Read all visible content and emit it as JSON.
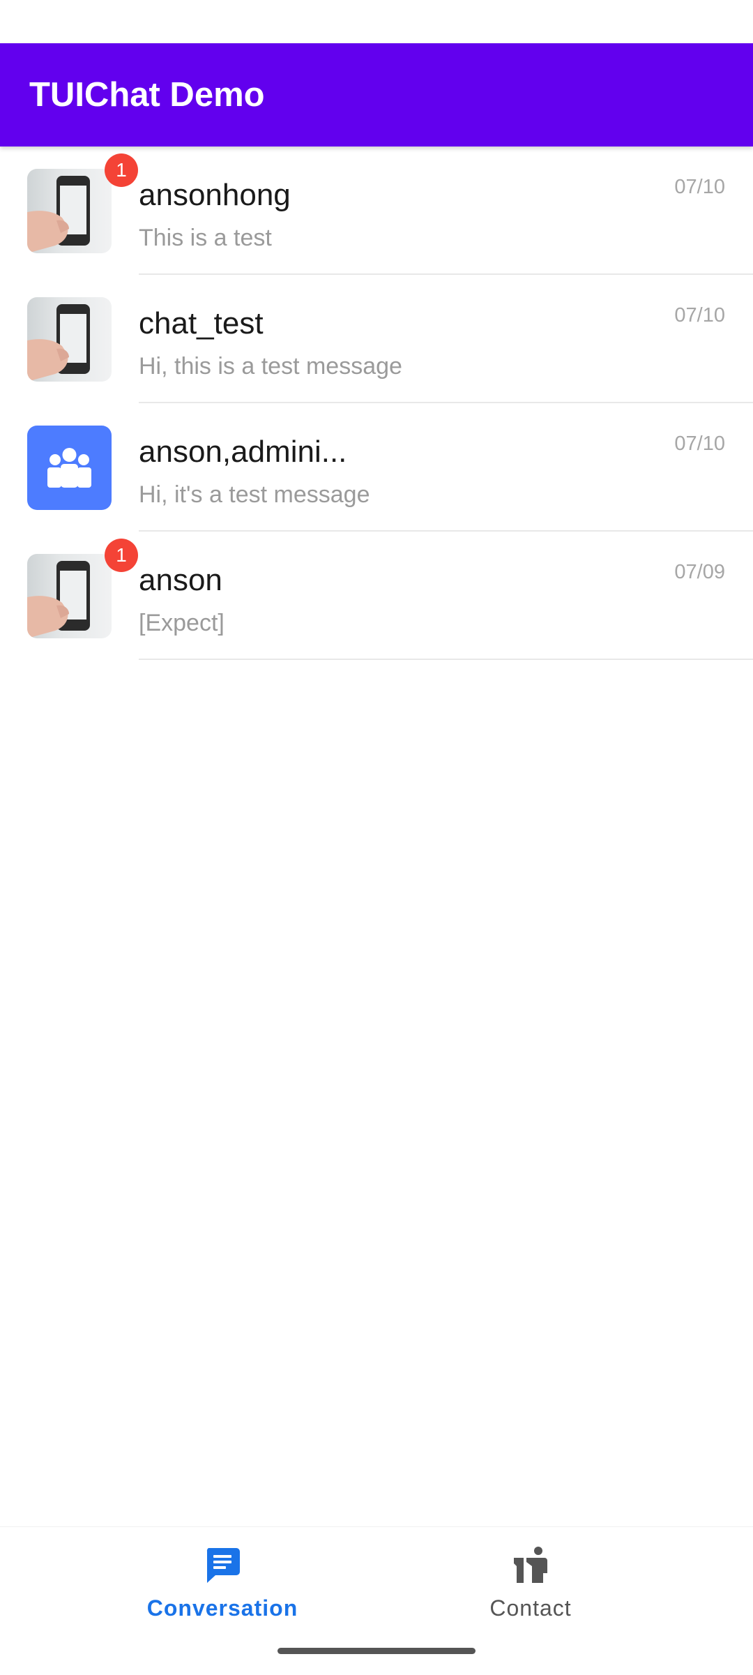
{
  "app": {
    "title": "TUIChat Demo"
  },
  "conversations": [
    {
      "name": "ansonhong",
      "preview": "This is a test",
      "time": "07/10",
      "unread": "1",
      "avatar": "photo-avatar"
    },
    {
      "name": "chat_test",
      "preview": "Hi, this is a test message",
      "time": "07/10",
      "unread": null,
      "avatar": "photo-avatar"
    },
    {
      "name": "anson,admini...",
      "preview": "Hi, it's a test message",
      "time": "07/10",
      "unread": null,
      "avatar": "group-avatar-icon"
    },
    {
      "name": "anson",
      "preview": "[Expect]",
      "time": "07/09",
      "unread": "1",
      "avatar": "photo-avatar"
    }
  ],
  "bottom_nav": {
    "tabs": [
      {
        "label": "Conversation",
        "icon": "chat-bubble-icon",
        "active": true
      },
      {
        "label": "Contact",
        "icon": "contact-icon",
        "active": false
      }
    ]
  },
  "colors": {
    "app_bar": "#6200ee",
    "badge": "#f44336",
    "group_avatar": "#4d7cff",
    "active_tab": "#1a73e8",
    "inactive_tab": "#555555"
  }
}
